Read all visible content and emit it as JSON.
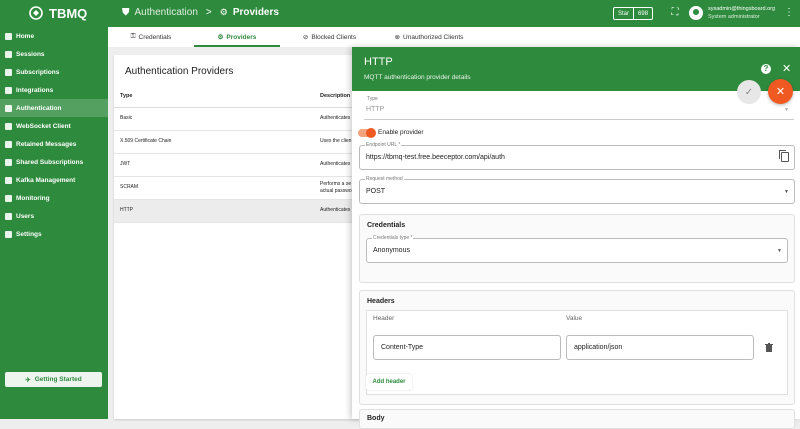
{
  "app": {
    "title": "TBMQ"
  },
  "breadcrumb": {
    "parent": "Authentication",
    "separator": ">",
    "current": "Providers"
  },
  "github": {
    "star_label": "Star",
    "count": "698"
  },
  "user": {
    "email": "sysadmin@thingsboard.org",
    "role": "System administrator"
  },
  "sidebar": {
    "items": [
      {
        "label": "Home",
        "icon": "home-icon"
      },
      {
        "label": "Sessions",
        "icon": "sessions-icon"
      },
      {
        "label": "Subscriptions",
        "icon": "filter-icon"
      },
      {
        "label": "Integrations",
        "icon": "integrations-icon"
      },
      {
        "label": "Authentication",
        "icon": "shield-icon",
        "active": true
      },
      {
        "label": "WebSocket Client",
        "icon": "websocket-icon"
      },
      {
        "label": "Retained Messages",
        "icon": "mail-icon"
      },
      {
        "label": "Shared Subscriptions",
        "icon": "share-icon"
      },
      {
        "label": "Kafka Management",
        "icon": "kafka-icon"
      },
      {
        "label": "Monitoring",
        "icon": "chart-icon"
      },
      {
        "label": "Users",
        "icon": "users-icon"
      },
      {
        "label": "Settings",
        "icon": "gear-icon"
      }
    ],
    "getting_started": "Getting Started"
  },
  "tabs": [
    {
      "label": "Credentials",
      "icon": "credentials-icon"
    },
    {
      "label": "Providers",
      "icon": "gear-icon",
      "active": true
    },
    {
      "label": "Blocked Clients",
      "icon": "blocked-icon"
    },
    {
      "label": "Unauthorized Clients",
      "icon": "unauthorized-icon"
    }
  ],
  "providers": {
    "title": "Authentication Providers",
    "columns": [
      "Type",
      "Description"
    ],
    "rows": [
      {
        "type": "Basic",
        "desc": "Authenticates"
      },
      {
        "type": "X.509 Certificate Chain",
        "desc": "Uses the clien"
      },
      {
        "type": "JWT",
        "desc": "Authenticates"
      },
      {
        "type": "SCRAM",
        "desc": "Performs a se",
        "desc2": "actual passwo"
      },
      {
        "type": "HTTP",
        "desc": "Authenticates",
        "selected": true
      }
    ]
  },
  "panel": {
    "title": "HTTP",
    "subtitle": "MQTT authentication provider details",
    "type_label": "Type",
    "type_value": "HTTP",
    "enable_label": "Enable provider",
    "endpoint_label": "Endpoint URL *",
    "endpoint_value": "https://tbmq-test.free.beeceptor.com/api/auth",
    "method_label": "Request method",
    "method_value": "POST",
    "credentials_title": "Credentials",
    "cred_type_label": "Credentials type *",
    "cred_type_value": "Anonymous",
    "headers_title": "Headers",
    "header_col": "Header",
    "value_col": "Value",
    "header_key": "Content-Type",
    "header_value": "application/json",
    "add_header": "Add header",
    "body_title": "Body"
  }
}
